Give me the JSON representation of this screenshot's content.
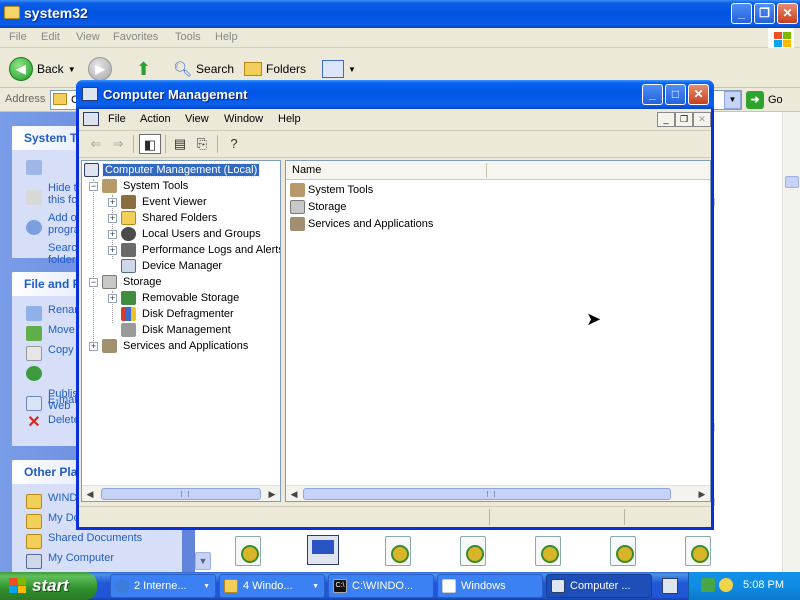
{
  "explorer": {
    "title": "system32",
    "menu": [
      "File",
      "Edit",
      "View",
      "Favorites",
      "Tools",
      "Help"
    ],
    "toolbar": {
      "back": "Back",
      "search": "Search",
      "folders": "Folders"
    },
    "address_label": "Address",
    "address_value": "C",
    "go": "Go",
    "taskpane": {
      "system_tasks": {
        "title": "System T",
        "items": [
          "Hide t\nthis fo",
          "Add o\nprogra",
          "Searc\nfolder"
        ]
      },
      "file_folder": {
        "title": "File and F",
        "items": [
          "Renan",
          "Move",
          "Copy",
          "Publis\nWeb",
          "E-mail",
          "Delete"
        ]
      },
      "other_places": {
        "title": "Other Pla",
        "items": [
          "WINDO",
          "My Do",
          "Shared Documents",
          "My Computer"
        ]
      }
    },
    "right_fragments": [
      "ll",
      "ll",
      "ll"
    ]
  },
  "mmc": {
    "title": "Computer Management",
    "menu": [
      "File",
      "Action",
      "View",
      "Window",
      "Help"
    ],
    "tree": {
      "root": "Computer Management (Local)",
      "nodes": [
        {
          "label": "System Tools",
          "icon": "tools-icon"
        },
        {
          "label": "Event Viewer",
          "icon": "event-viewer-icon"
        },
        {
          "label": "Shared Folders",
          "icon": "shared-folders-icon"
        },
        {
          "label": "Local Users and Groups",
          "icon": "users-icon"
        },
        {
          "label": "Performance Logs and Alerts",
          "icon": "performance-icon"
        },
        {
          "label": "Device Manager",
          "icon": "device-manager-icon"
        },
        {
          "label": "Storage",
          "icon": "storage-icon"
        },
        {
          "label": "Removable Storage",
          "icon": "removable-storage-icon"
        },
        {
          "label": "Disk Defragmenter",
          "icon": "defrag-icon"
        },
        {
          "label": "Disk Management",
          "icon": "disk-management-icon"
        },
        {
          "label": "Services and Applications",
          "icon": "services-icon"
        }
      ]
    },
    "list": {
      "column": "Name",
      "rows": [
        "System Tools",
        "Storage",
        "Services and Applications"
      ]
    }
  },
  "taskbar": {
    "start": "start",
    "tasks": [
      {
        "label": "2 Interne...",
        "icon": "ie-icon",
        "dropdown": true
      },
      {
        "label": "4 Windo...",
        "icon": "folder-icon",
        "dropdown": true
      },
      {
        "label": "C:\\WINDO...",
        "icon": "cmd-icon",
        "dropdown": false
      },
      {
        "label": "Windows",
        "icon": "window-icon",
        "dropdown": false
      },
      {
        "label": "Computer ...",
        "icon": "computer-management-icon",
        "dropdown": false,
        "active": true
      }
    ],
    "clock": "5:08 PM"
  },
  "colors": {
    "xp_blue": "#0055e5",
    "selection": "#316ac5",
    "start_green": "#2f8f2c",
    "taskpane": "#6f92e3"
  }
}
